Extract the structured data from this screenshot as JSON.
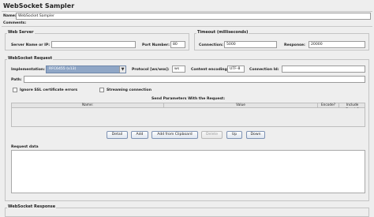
{
  "title": "WebSocket Sampler",
  "name_label": "Name:",
  "name_value": "WebSocket Sampler",
  "comments_label": "Comments:",
  "web_server": {
    "title": "Web Server",
    "server_label": "Server Name or IP:",
    "server_value": "",
    "port_label": "Port Number:",
    "port_value": "80"
  },
  "timeout": {
    "title": "Timeout (milliseconds)",
    "connection_label": "Connection:",
    "connection_value": "5000",
    "response_label": "Response:",
    "response_value": "20000"
  },
  "request": {
    "title": "WebSocket Request",
    "implementation_label": "Implementation:",
    "implementation_value": "RFC6455 (v13)",
    "protocol_label": "Protocol [ws/wss]:",
    "protocol_value": "ws",
    "encoding_label": "Content encoding:",
    "encoding_value": "UTF-8",
    "connection_id_label": "Connection Id:",
    "connection_id_value": "",
    "path_label": "Path:",
    "path_value": "",
    "ignore_ssl_label": "Ignore SSL certificate errors",
    "ignore_ssl_checked": false,
    "streaming_label": "Streaming connection",
    "streaming_checked": false
  },
  "params": {
    "caption": "Send Parameters With the Request:",
    "columns": [
      "Name:",
      "Value",
      "Encode?",
      "Include Equals?"
    ]
  },
  "buttons": {
    "detail": "Detail",
    "add": "Add",
    "add_clipboard": "Add from Clipboard",
    "delete": "Delete",
    "up": "Up",
    "down": "Down"
  },
  "request_data_label": "Request data",
  "response_title": "WebSocket Response",
  "colors": {
    "background": "#eeeeee",
    "select_bg": "#8fa6c6",
    "button_border": "#7f93b4"
  }
}
